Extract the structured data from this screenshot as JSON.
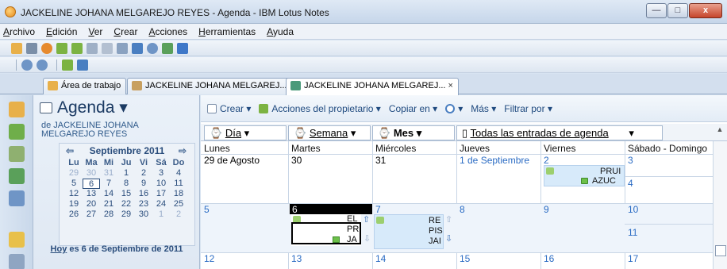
{
  "window": {
    "title": "JACKELINE JOHANA MELGAREJO REYES - Agenda - IBM Lotus Notes",
    "minimize": "—",
    "maximize": "□",
    "close": "x"
  },
  "menu": [
    "Archivo",
    "Edición",
    "Ver",
    "Crear",
    "Acciones",
    "Herramientas",
    "Ayuda"
  ],
  "tabs": [
    {
      "label": "Área de trabajo",
      "icon": "workspace-icon"
    },
    {
      "label": "JACKELINE JOHANA MELGAREJ...",
      "close": "×",
      "icon": "mail-icon"
    },
    {
      "label": "JACKELINE JOHANA MELGAREJ...",
      "close": "×",
      "icon": "calendar-icon"
    }
  ],
  "nav": {
    "title": "Agenda ▾",
    "subtitle": "de JACKELINE JOHANA MELGAREJO REYES",
    "month_label": "Septiembre 2011",
    "prev": "⇦",
    "next": "⇨",
    "weekdays": [
      "Lu",
      "Ma",
      "Mi",
      "Ju",
      "Vi",
      "Sá",
      "Do"
    ],
    "weeks": [
      [
        "29",
        "30",
        "31",
        "1",
        "2",
        "3",
        "4"
      ],
      [
        "5",
        "6",
        "7",
        "8",
        "9",
        "10",
        "11"
      ],
      [
        "12",
        "13",
        "14",
        "15",
        "16",
        "17",
        "18"
      ],
      [
        "19",
        "20",
        "21",
        "22",
        "23",
        "24",
        "25"
      ],
      [
        "26",
        "27",
        "28",
        "29",
        "30",
        "1",
        "2"
      ]
    ],
    "today_link": "Hoy",
    "today_text": " es 6 de Septiembre de 2011"
  },
  "actions": {
    "crear": "Crear ▾",
    "acciones": "Acciones del propietario ▾",
    "copiar": "Copiar en ▾",
    "buscar": "▾",
    "mas": "Más ▾",
    "filtrar": "Filtrar por ▾"
  },
  "view_tabs": {
    "dia": "Día",
    "semana": "Semana",
    "mes": "Mes",
    "todas": "Todas las entradas de agenda",
    "caret": "▾"
  },
  "columns": [
    "Lunes",
    "Martes",
    "Miércoles",
    "Jueves",
    "Viernes",
    "Sábado - Domingo"
  ],
  "weeks": [
    {
      "days": [
        "29 de Agosto",
        "30",
        "31",
        "1 de Septiembre",
        "2",
        "3"
      ],
      "weekend2": "4"
    },
    {
      "days": [
        "5",
        "6",
        "7",
        "8",
        "9",
        "10"
      ],
      "weekend2": "11"
    },
    {
      "days": [
        "12",
        "13",
        "14",
        "15",
        "16",
        "17"
      ]
    }
  ],
  "events": {
    "fri_1": "PRUI",
    "fri_2": "AZUC",
    "tue_1": "EL",
    "tue_2": "PR",
    "tue_3": "JA",
    "wed_1": "RE",
    "wed_2": "PIS",
    "wed_3": "JAI"
  },
  "colors": {
    "accent": "#2b6cc4",
    "event_bg": "#d7eafa",
    "today_bg": "#000000"
  }
}
